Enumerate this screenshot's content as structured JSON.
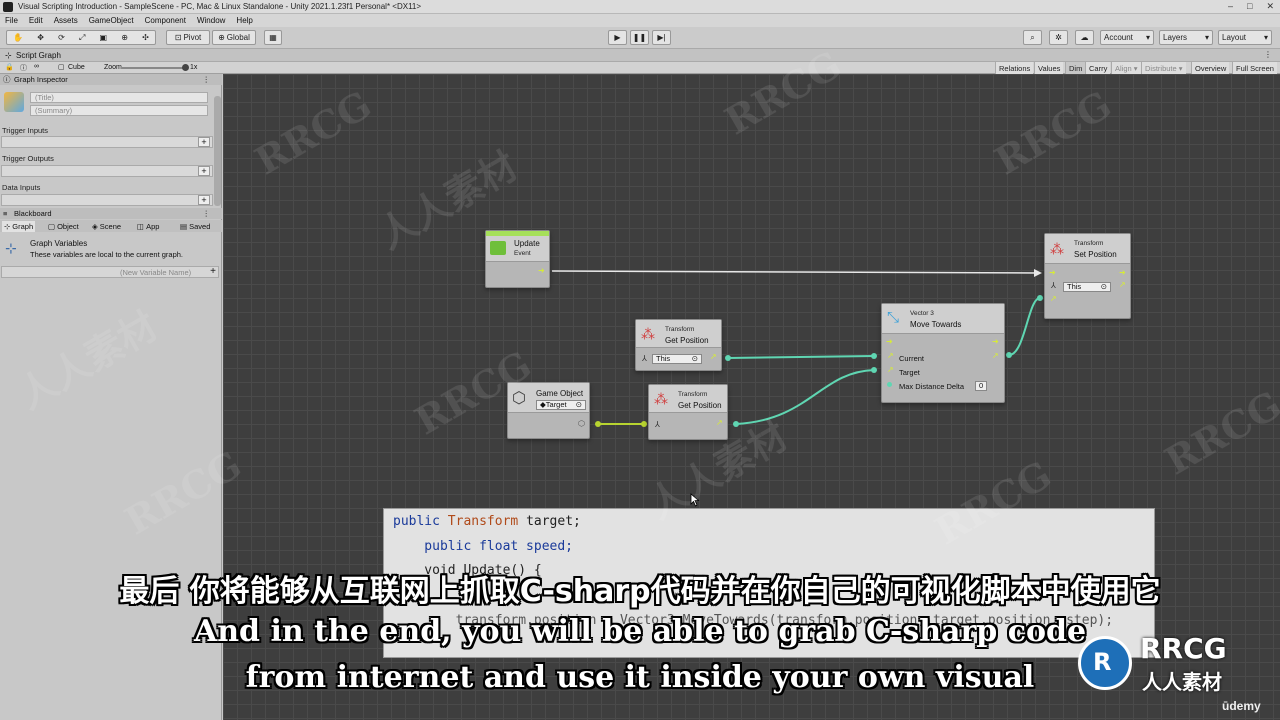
{
  "window": {
    "title": "Visual Scripting Introduction - SampleScene - PC, Mac & Linux Standalone - Unity 2021.1.23f1 Personal* <DX11>",
    "controls": [
      "–",
      "□",
      "✕"
    ]
  },
  "menu": [
    "File",
    "Edit",
    "Assets",
    "GameObject",
    "Component",
    "Window",
    "Help"
  ],
  "toolbar": {
    "pivot": "Pivot",
    "global": "Global",
    "account": "Account",
    "layers": "Layers",
    "layout": "Layout"
  },
  "script_graph": {
    "tab": "Script Graph",
    "object": "Cube",
    "zoom_label": "Zoom",
    "zoom_value": "1x",
    "zoom_level": 1.0,
    "buttons": [
      "Relations",
      "Values",
      "Dim",
      "Carry",
      "Align ▾",
      "Distribute ▾",
      "Overview",
      "Full Screen"
    ]
  },
  "inspector": {
    "header": "Graph Inspector",
    "title_placeholder": "(Title)",
    "summary_placeholder": "(Summary)",
    "trigger_inputs": "Trigger Inputs",
    "trigger_outputs": "Trigger Outputs",
    "data_inputs": "Data Inputs"
  },
  "blackboard": {
    "header": "Blackboard",
    "tabs": [
      "Graph",
      "Object",
      "Scene",
      "App",
      "Saved"
    ],
    "heading": "Graph Variables",
    "description": "These variables are local to the current graph.",
    "new_var_placeholder": "(New Variable Name)"
  },
  "nodes": {
    "update": {
      "title": "Update",
      "subtitle": "Event",
      "accent": "#a6e05a"
    },
    "set_position": {
      "category": "Transform",
      "title": "Set Position",
      "target": "This"
    },
    "move_towards": {
      "category": "Vector 3",
      "title": "Move Towards",
      "current": "Current",
      "target": "Target",
      "max_delta": "Max Distance Delta",
      "max_delta_value": "0"
    },
    "get_position_1": {
      "category": "Transform",
      "title": "Get Position",
      "target": "This"
    },
    "get_position_2": {
      "category": "Transform",
      "title": "Get Position"
    },
    "game_object": {
      "title": "Game Object",
      "value": "◆Target"
    }
  },
  "code": {
    "line1_kw": "public",
    "line1_ty": "Transform",
    "line1_rest": " target;",
    "line2": "    public float speed;",
    "line3": "    void Update() {",
    "line4": "        transform.position = Vector3.MoveTowards(transform.position, target.position, step);"
  },
  "subtitles": {
    "cn": "最后 你将能够从互联网上抓取C-sharp代码并在你自己的可视化脚本中使用它",
    "en1": "And in the end, you will be able to grab C-sharp code",
    "en2": "from internet and use it inside your own visual"
  },
  "watermark": {
    "text": "RRCG",
    "cn": "人人素材"
  },
  "brand": {
    "name": "RRCG",
    "cn": "人人素材",
    "udemy": "ūdemy"
  },
  "colors": {
    "flow": "#e8e8e8",
    "data": "#5fd6b2",
    "object": "#b8d430",
    "accent_green": "#a6e05a"
  }
}
